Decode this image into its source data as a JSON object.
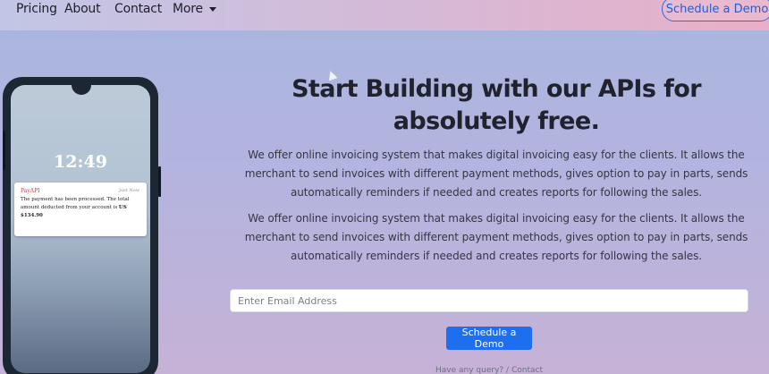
{
  "nav": {
    "links": [
      "Pricing",
      "About",
      "Contact"
    ],
    "more_label": "More",
    "demo_label": "Schedule a Demo"
  },
  "phone": {
    "time": "12:49",
    "notification": {
      "app": "PayAPI",
      "time": "Just Now",
      "body": "The payment has been processed. The total amount deducted from your account is",
      "amount": "US $134.90"
    }
  },
  "hero": {
    "title": "Start Building with our APIs for absolutely free.",
    "paragraphs": [
      "We offer online invoicing system that makes digital invoicing easy for the clients. It allows the merchant to send invoices with different payment methods, gives option to pay in parts, sends automatically reminders if needed and creates reports for following the sales.",
      "We offer online invoicing system that makes digital invoicing easy for the clients. It allows the merchant to send invoices with different payment methods, gives option to pay in parts, sends automatically reminders if needed and creates reports for following the sales."
    ],
    "email_placeholder": "Enter Email Address",
    "cta_label": "Schedule a Demo",
    "queries_text": "Have any query?",
    "contact_link": "Contact Us"
  },
  "icons": {
    "more": "chevron-down-icon",
    "cursor": "mouse-cursor-icon"
  },
  "colors": {
    "accent": "#1e6ff0",
    "nav_border": "#2d6be0",
    "notification_app": "#d23a3a"
  }
}
